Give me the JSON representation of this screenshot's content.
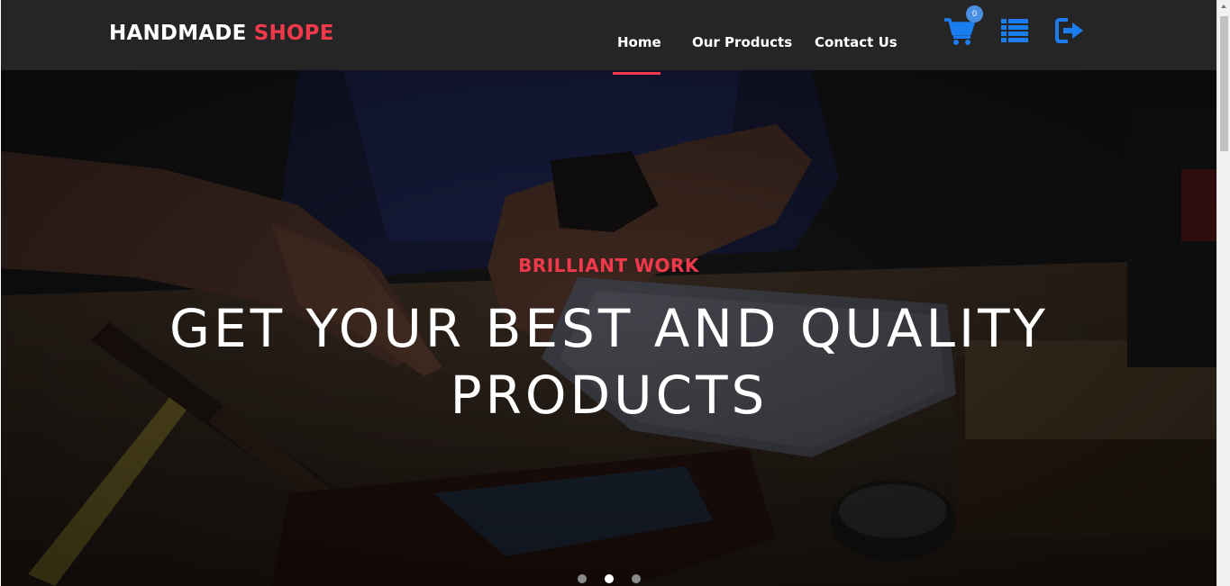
{
  "brand": {
    "main": "HANDMADE",
    "accent": "SHOPE"
  },
  "nav": {
    "items": [
      {
        "label": "Home",
        "active": true
      },
      {
        "label": "Our Products",
        "active": false
      },
      {
        "label": "Contact Us",
        "active": false
      }
    ]
  },
  "icons": {
    "cart": {
      "name": "shopping-cart-icon",
      "count": "0"
    },
    "list": {
      "name": "list-icon"
    },
    "logout": {
      "name": "logout-icon"
    }
  },
  "hero": {
    "subtitle": "BRILLIANT WORK",
    "title": "GET YOUR BEST AND QUALITY PRODUCTS",
    "slides": 3,
    "active_slide": 2
  },
  "colors": {
    "accent": "#f0394a",
    "icon_blue": "#1a7df0",
    "header_bg": "#252525"
  }
}
